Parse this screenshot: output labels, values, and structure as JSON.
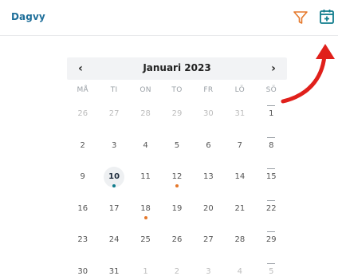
{
  "header": {
    "view_label": "Dagvy",
    "filter_icon": "filter-icon",
    "add_icon": "calendar-plus-icon",
    "accent_color": "#1f6f9a",
    "filter_color": "#e5782b",
    "add_color": "#0f7c8c"
  },
  "calendar": {
    "month_title": "Januari 2023",
    "prev_label": "‹",
    "next_label": "›",
    "weekdays": [
      "MÅ",
      "TI",
      "ON",
      "TO",
      "FR",
      "LÖ",
      "SÖ"
    ],
    "weeks": [
      [
        {
          "n": "26",
          "other": true
        },
        {
          "n": "27",
          "other": true
        },
        {
          "n": "28",
          "other": true
        },
        {
          "n": "29",
          "other": true
        },
        {
          "n": "30",
          "other": true
        },
        {
          "n": "31",
          "other": true
        },
        {
          "n": "1"
        }
      ],
      [
        {
          "n": "2"
        },
        {
          "n": "3"
        },
        {
          "n": "4"
        },
        {
          "n": "5"
        },
        {
          "n": "6"
        },
        {
          "n": "7"
        },
        {
          "n": "8"
        }
      ],
      [
        {
          "n": "9"
        },
        {
          "n": "10",
          "today": true,
          "dot": "teal"
        },
        {
          "n": "11"
        },
        {
          "n": "12",
          "dot": "orange"
        },
        {
          "n": "13"
        },
        {
          "n": "14"
        },
        {
          "n": "15"
        }
      ],
      [
        {
          "n": "16"
        },
        {
          "n": "17"
        },
        {
          "n": "18",
          "dot": "orange"
        },
        {
          "n": "19"
        },
        {
          "n": "20"
        },
        {
          "n": "21"
        },
        {
          "n": "22"
        }
      ],
      [
        {
          "n": "23"
        },
        {
          "n": "24"
        },
        {
          "n": "25"
        },
        {
          "n": "26"
        },
        {
          "n": "27"
        },
        {
          "n": "28"
        },
        {
          "n": "29"
        }
      ],
      [
        {
          "n": "30"
        },
        {
          "n": "31"
        },
        {
          "n": "1",
          "other": true
        },
        {
          "n": "2",
          "other": true
        },
        {
          "n": "3",
          "other": true
        },
        {
          "n": "4",
          "other": true
        },
        {
          "n": "5",
          "other": true
        }
      ]
    ]
  },
  "annotation": {
    "arrow_color": "#e0201b"
  }
}
